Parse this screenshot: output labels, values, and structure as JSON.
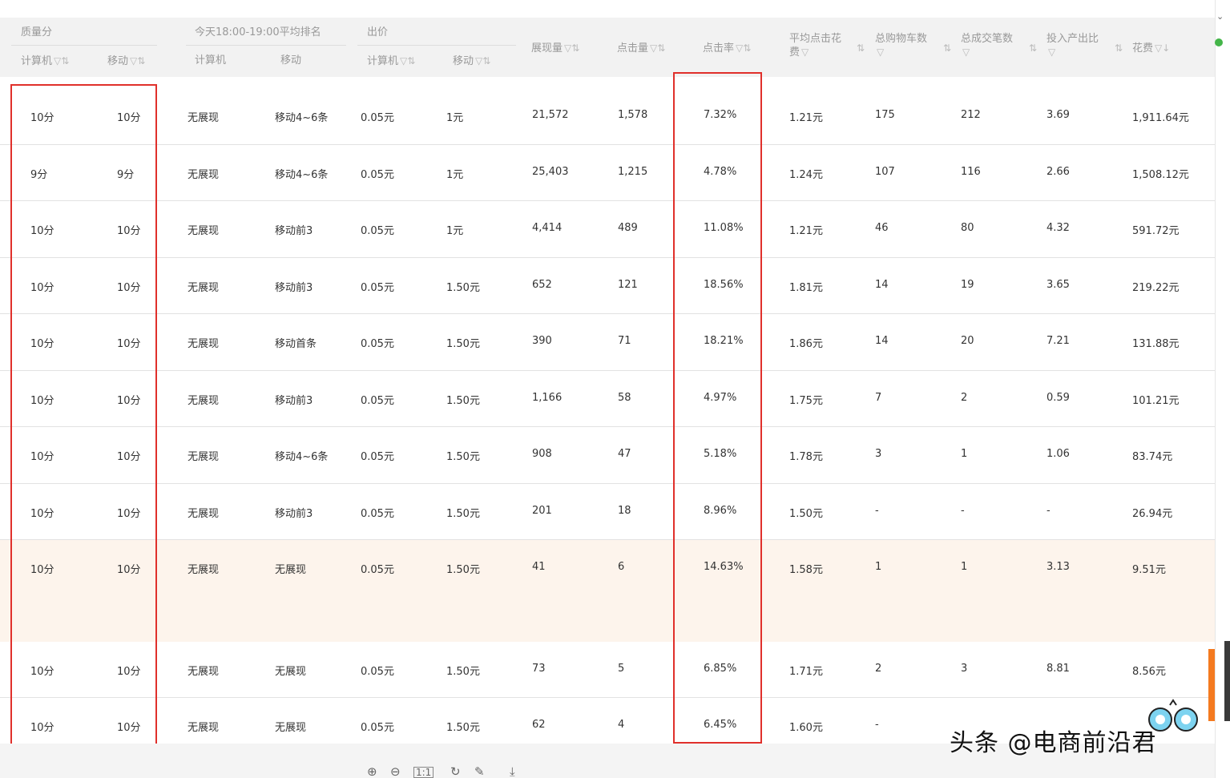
{
  "header": {
    "group_quality": "质量分",
    "group_rank": "今天18:00-19:00平均排名",
    "group_bid": "出价",
    "q_pc": "计算机",
    "q_mobile": "移动",
    "r_pc": "计算机",
    "r_mobile": "移动",
    "b_pc": "计算机",
    "b_mobile": "移动",
    "impressions": "展现量",
    "clicks": "点击量",
    "ctr": "点击率",
    "avg_cpc": "平均点击花费",
    "carts": "总购物车数",
    "orders": "总成交笔数",
    "roi": "投入产出比",
    "cost": "花费"
  },
  "rows": [
    {
      "q_pc": "10分",
      "q_m": "10分",
      "r_pc": "无展现",
      "r_m": "移动4~6条",
      "b_pc": "0.05元",
      "b_m": "1元",
      "imp": "21,572",
      "clk": "1,578",
      "ctr": "7.32%",
      "cpc": "1.21元",
      "cart": "175",
      "ord": "212",
      "roi": "3.69",
      "cost": "1,911.64元"
    },
    {
      "q_pc": "9分",
      "q_m": "9分",
      "r_pc": "无展现",
      "r_m": "移动4~6条",
      "b_pc": "0.05元",
      "b_m": "1元",
      "imp": "25,403",
      "clk": "1,215",
      "ctr": "4.78%",
      "cpc": "1.24元",
      "cart": "107",
      "ord": "116",
      "roi": "2.66",
      "cost": "1,508.12元"
    },
    {
      "q_pc": "10分",
      "q_m": "10分",
      "r_pc": "无展现",
      "r_m": "移动前3",
      "b_pc": "0.05元",
      "b_m": "1元",
      "imp": "4,414",
      "clk": "489",
      "ctr": "11.08%",
      "cpc": "1.21元",
      "cart": "46",
      "ord": "80",
      "roi": "4.32",
      "cost": "591.72元"
    },
    {
      "q_pc": "10分",
      "q_m": "10分",
      "r_pc": "无展现",
      "r_m": "移动前3",
      "b_pc": "0.05元",
      "b_m": "1.50元",
      "imp": "652",
      "clk": "121",
      "ctr": "18.56%",
      "cpc": "1.81元",
      "cart": "14",
      "ord": "19",
      "roi": "3.65",
      "cost": "219.22元"
    },
    {
      "q_pc": "10分",
      "q_m": "10分",
      "r_pc": "无展现",
      "r_m": "移动首条",
      "b_pc": "0.05元",
      "b_m": "1.50元",
      "imp": "390",
      "clk": "71",
      "ctr": "18.21%",
      "cpc": "1.86元",
      "cart": "14",
      "ord": "20",
      "roi": "7.21",
      "cost": "131.88元"
    },
    {
      "q_pc": "10分",
      "q_m": "10分",
      "r_pc": "无展现",
      "r_m": "移动前3",
      "b_pc": "0.05元",
      "b_m": "1.50元",
      "imp": "1,166",
      "clk": "58",
      "ctr": "4.97%",
      "cpc": "1.75元",
      "cart": "7",
      "ord": "2",
      "roi": "0.59",
      "cost": "101.21元"
    },
    {
      "q_pc": "10分",
      "q_m": "10分",
      "r_pc": "无展现",
      "r_m": "移动4~6条",
      "b_pc": "0.05元",
      "b_m": "1.50元",
      "imp": "908",
      "clk": "47",
      "ctr": "5.18%",
      "cpc": "1.78元",
      "cart": "3",
      "ord": "1",
      "roi": "1.06",
      "cost": "83.74元"
    },
    {
      "q_pc": "10分",
      "q_m": "10分",
      "r_pc": "无展现",
      "r_m": "移动前3",
      "b_pc": "0.05元",
      "b_m": "1.50元",
      "imp": "201",
      "clk": "18",
      "ctr": "8.96%",
      "cpc": "1.50元",
      "cart": "-",
      "ord": "-",
      "roi": "-",
      "cost": "26.94元"
    },
    {
      "q_pc": "10分",
      "q_m": "10分",
      "r_pc": "无展现",
      "r_m": "无展现",
      "b_pc": "0.05元",
      "b_m": "1.50元",
      "imp": "41",
      "clk": "6",
      "ctr": "14.63%",
      "cpc": "1.58元",
      "cart": "1",
      "ord": "1",
      "roi": "3.13",
      "cost": "9.51元"
    },
    {
      "q_pc": "",
      "q_m": "",
      "r_pc": "",
      "r_m": "",
      "b_pc": "",
      "b_m": "",
      "imp": "",
      "clk": "",
      "ctr": "",
      "cpc": "",
      "cart": "",
      "ord": "",
      "roi": "",
      "cost": ""
    },
    {
      "q_pc": "10分",
      "q_m": "10分",
      "r_pc": "无展现",
      "r_m": "无展现",
      "b_pc": "0.05元",
      "b_m": "1.50元",
      "imp": "73",
      "clk": "5",
      "ctr": "6.85%",
      "cpc": "1.71元",
      "cart": "2",
      "ord": "3",
      "roi": "8.81",
      "cost": "8.56元"
    },
    {
      "q_pc": "10分",
      "q_m": "10分",
      "r_pc": "无展现",
      "r_m": "无展现",
      "b_pc": "0.05元",
      "b_m": "1.50元",
      "imp": "62",
      "clk": "4",
      "ctr": "6.45%",
      "cpc": "1.60元",
      "cart": "-",
      "ord": "",
      "roi": "",
      "cost": ""
    }
  ],
  "watermark": "头条 @电商前沿君",
  "colors": {
    "highlight_box": "#e0302b",
    "header_bg": "#f2f2f2",
    "row_highlight": "#fdf4ec",
    "side_tab": "#f47a20"
  },
  "footer_icons": [
    "zoom-in-icon",
    "zoom-out-icon",
    "fit-icon",
    "rotate-icon",
    "edit-icon",
    "download-icon"
  ]
}
